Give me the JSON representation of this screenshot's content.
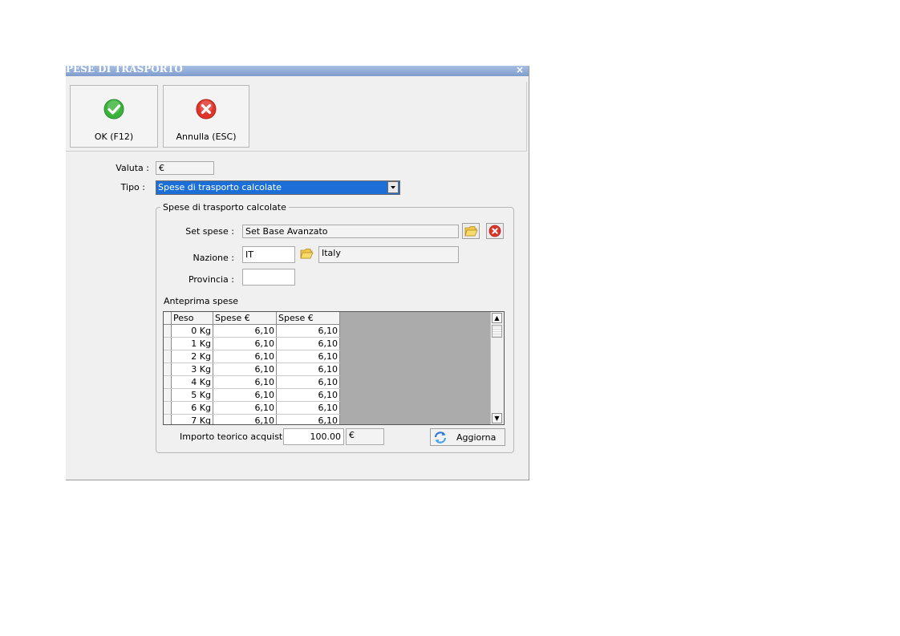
{
  "window": {
    "title": "PESE DI TRASPORTO",
    "close_glyph": "×"
  },
  "toolbar": {
    "ok_label": "OK (F12)",
    "cancel_label": "Annulla (ESC)",
    "ok_icon": "check-circle-icon",
    "cancel_icon": "x-circle-icon"
  },
  "form": {
    "valuta_label": "Valuta :",
    "valuta_value": "€",
    "tipo_label": "Tipo :",
    "tipo_value": "Spese di trasporto calcolate"
  },
  "group": {
    "title": "Spese di trasporto calcolate",
    "set_spese_label": "Set spese :",
    "set_spese_value": "Set Base Avanzato",
    "nazione_label": "Nazione :",
    "nazione_code": "IT",
    "nazione_name": "Italy",
    "provincia_label": "Provincia :",
    "provincia_value": "",
    "anteprima_label": "Anteprima spese",
    "importo_label": "Importo teorico acquisto:",
    "importo_value": "100.00",
    "importo_currency": "€",
    "aggiorna_label": "Aggiorna"
  },
  "table": {
    "columns": [
      "Peso",
      "Spese €",
      "Spese €"
    ],
    "rows": [
      [
        "0 Kg",
        "6,10",
        "6,10"
      ],
      [
        "1 Kg",
        "6,10",
        "6,10"
      ],
      [
        "2 Kg",
        "6,10",
        "6,10"
      ],
      [
        "3 Kg",
        "6,10",
        "6,10"
      ],
      [
        "4 Kg",
        "6,10",
        "6,10"
      ],
      [
        "5 Kg",
        "6,10",
        "6,10"
      ],
      [
        "6 Kg",
        "6,10",
        "6,10"
      ],
      [
        "7 Kg",
        "6,10",
        "6,10"
      ]
    ]
  },
  "colors": {
    "title_bar": "#8ea9d8",
    "selection": "#1b6fd6",
    "ok_green": "#3bb33b",
    "cancel_red": "#e0342a",
    "folder_yellow": "#f2c84b"
  }
}
